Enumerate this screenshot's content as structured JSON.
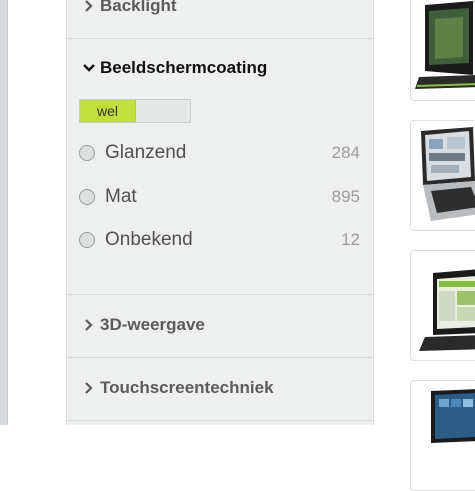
{
  "filters": {
    "backlight": {
      "label": "Backlight"
    },
    "coating": {
      "label": "Beeldschermcoating",
      "toggle_on_label": "wel",
      "options": [
        {
          "label": "Glanzend",
          "count": "284"
        },
        {
          "label": "Mat",
          "count": "895"
        },
        {
          "label": "Onbekend",
          "count": "12"
        }
      ]
    },
    "display3d": {
      "label": "3D-weergave"
    },
    "touchscreen": {
      "label": "Touchscreentechniek"
    }
  },
  "products": [
    {
      "name": "laptop-thumbnail"
    },
    {
      "name": "laptop-thumbnail"
    },
    {
      "name": "laptop-thumbnail"
    },
    {
      "name": "laptop-thumbnail"
    }
  ],
  "colors": {
    "toggle_active": "#c1de3a",
    "panel_bg": "#eef0f0"
  },
  "icons": {
    "collapsed": "chevron-right-icon",
    "expanded": "chevron-down-icon",
    "radio": "radio-unchecked-icon"
  }
}
